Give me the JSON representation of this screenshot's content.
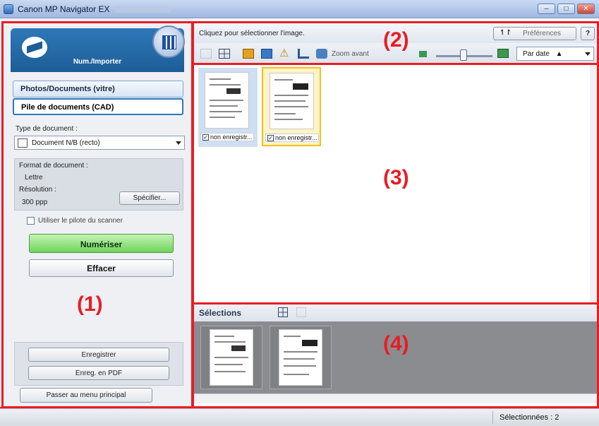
{
  "window": {
    "title": "Canon MP Navigator EX",
    "controls": {
      "minimize": "–",
      "maximize": "□",
      "close": "✕"
    }
  },
  "left_panel": {
    "banner_label": "Num./Importer",
    "modes": [
      "Photos/Documents (vitre)",
      "Pile de documents (CAD)"
    ],
    "active_mode_index": 1,
    "doc_type_label": "Type de document :",
    "doc_type_value": "Document N/B (recto)",
    "format_label": "Format de document :",
    "format_value": "Lettre",
    "resolution_label": "Résolution :",
    "resolution_value": "300 ppp",
    "specify_button": "Spécifier...",
    "scanner_driver_label": "Utiliser le pilote du scanner",
    "scan_button": "Numériser",
    "clear_button": "Effacer",
    "save_button": "Enregistrer",
    "save_pdf_button": "Enreg. en PDF",
    "main_menu_button": "Passer au menu principal"
  },
  "toolbar": {
    "hint": "Cliquez pour sélectionner l'image.",
    "preferences_button": "Préférences",
    "help_button": "?",
    "zoom_label": "Zoom avant",
    "sort_value": "Par date"
  },
  "thumbnails": [
    {
      "caption": "non enregistr...",
      "checked": true,
      "selected": false
    },
    {
      "caption": "non enregistr...",
      "checked": true,
      "selected": true
    }
  ],
  "selections": {
    "title": "Sélections"
  },
  "status": {
    "selected_text": "Sélectionnées : 2"
  },
  "callouts": [
    "(1)",
    "(2)",
    "(3)",
    "(4)"
  ],
  "colors": {
    "callout_red": "#ea1c24",
    "banner_blue": "#2e78b8",
    "scan_green": "#6fd35a"
  }
}
